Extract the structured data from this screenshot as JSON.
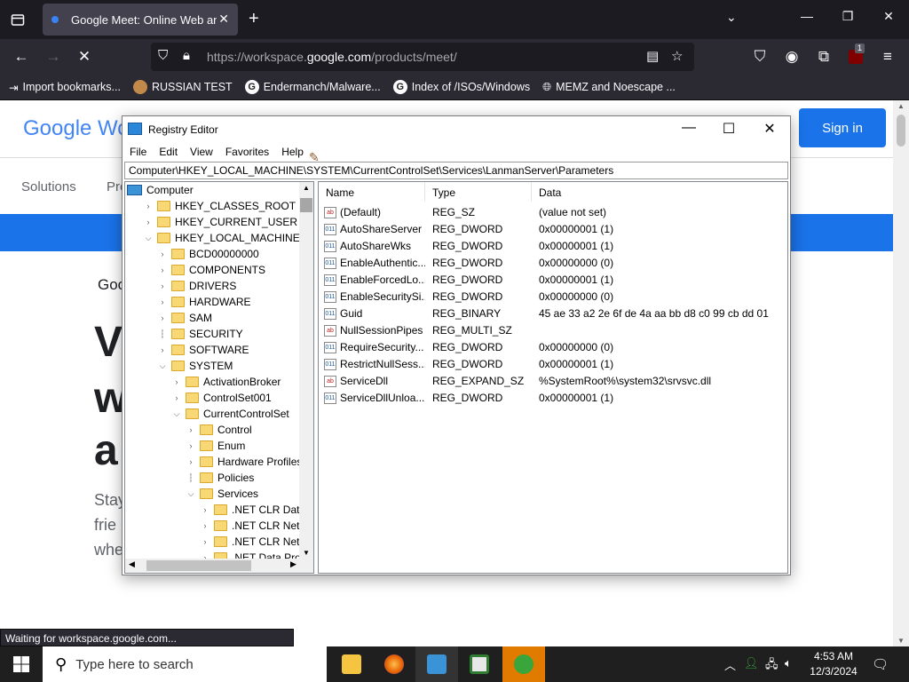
{
  "browser": {
    "tab_title": "Google Meet: Online Web and V",
    "url_prefix": "https://workspace.",
    "url_domain": "google.com",
    "url_suffix": "/products/meet/",
    "status_text": "Waiting for workspace.google.com...",
    "bookmarks": [
      {
        "label": "Import bookmarks...",
        "icon": "import-icon"
      },
      {
        "label": "RUSSIAN TEST",
        "icon": "site-icon"
      },
      {
        "label": "Endermanch/Malware...",
        "icon": "google-icon"
      },
      {
        "label": "Index of /ISOs/Windows",
        "icon": "google-icon"
      },
      {
        "label": "MEMZ and Noescape ...",
        "icon": "globe-icon"
      }
    ],
    "extension_badge": "1"
  },
  "page": {
    "logo_text": "Google Wo",
    "signin_label": "Sign in",
    "nav_solutions": "Solutions",
    "nav_pr": "Pro",
    "goc_text": "Goo",
    "big_lines": [
      "V",
      "w",
      "a"
    ],
    "small_lines": [
      "Stay",
      "frie",
      "whe"
    ]
  },
  "regedit": {
    "title": "Registry Editor",
    "menu": [
      "File",
      "Edit",
      "View",
      "Favorites",
      "Help"
    ],
    "address": "Computer\\HKEY_LOCAL_MACHINE\\SYSTEM\\CurrentControlSet\\Services\\LanmanServer\\Parameters",
    "tree": [
      {
        "label": "Computer",
        "level": 0,
        "arrow": "",
        "icon": "computer"
      },
      {
        "label": "HKEY_CLASSES_ROOT",
        "level": 1,
        "arrow": ">"
      },
      {
        "label": "HKEY_CURRENT_USER",
        "level": 1,
        "arrow": ">"
      },
      {
        "label": "HKEY_LOCAL_MACHINE",
        "level": 1,
        "arrow": "v"
      },
      {
        "label": "BCD00000000",
        "level": 2,
        "arrow": ">"
      },
      {
        "label": "COMPONENTS",
        "level": 2,
        "arrow": ">"
      },
      {
        "label": "DRIVERS",
        "level": 2,
        "arrow": ">"
      },
      {
        "label": "HARDWARE",
        "level": 2,
        "arrow": ">"
      },
      {
        "label": "SAM",
        "level": 2,
        "arrow": ">"
      },
      {
        "label": "SECURITY",
        "level": 2,
        "arrow": ""
      },
      {
        "label": "SOFTWARE",
        "level": 2,
        "arrow": ">"
      },
      {
        "label": "SYSTEM",
        "level": 2,
        "arrow": "v"
      },
      {
        "label": "ActivationBroker",
        "level": 3,
        "arrow": ">"
      },
      {
        "label": "ControlSet001",
        "level": 3,
        "arrow": ">"
      },
      {
        "label": "CurrentControlSet",
        "level": 3,
        "arrow": "v"
      },
      {
        "label": "Control",
        "level": 4,
        "arrow": ">"
      },
      {
        "label": "Enum",
        "level": 4,
        "arrow": ">"
      },
      {
        "label": "Hardware Profiles",
        "level": 4,
        "arrow": ">"
      },
      {
        "label": "Policies",
        "level": 4,
        "arrow": ""
      },
      {
        "label": "Services",
        "level": 4,
        "arrow": "v"
      },
      {
        "label": ".NET CLR Data",
        "level": 5,
        "arrow": ">"
      },
      {
        "label": ".NET CLR Network",
        "level": 5,
        "arrow": ">"
      },
      {
        "label": ".NET CLR Network",
        "level": 5,
        "arrow": ">"
      },
      {
        "label": ".NET Data Provide",
        "level": 5,
        "arrow": ">"
      }
    ],
    "columns": [
      "Name",
      "Type",
      "Data"
    ],
    "values": [
      {
        "name": "(Default)",
        "type": "REG_SZ",
        "data": "(value not set)",
        "icon": "string"
      },
      {
        "name": "AutoShareServer",
        "type": "REG_DWORD",
        "data": "0x00000001 (1)",
        "icon": "binary"
      },
      {
        "name": "AutoShareWks",
        "type": "REG_DWORD",
        "data": "0x00000001 (1)",
        "icon": "binary"
      },
      {
        "name": "EnableAuthentic...",
        "type": "REG_DWORD",
        "data": "0x00000000 (0)",
        "icon": "binary"
      },
      {
        "name": "EnableForcedLo...",
        "type": "REG_DWORD",
        "data": "0x00000001 (1)",
        "icon": "binary"
      },
      {
        "name": "EnableSecuritySi...",
        "type": "REG_DWORD",
        "data": "0x00000000 (0)",
        "icon": "binary"
      },
      {
        "name": "Guid",
        "type": "REG_BINARY",
        "data": "45 ae 33 a2 2e 6f de 4a aa bb d8 c0 99 cb dd 01",
        "icon": "binary"
      },
      {
        "name": "NullSessionPipes",
        "type": "REG_MULTI_SZ",
        "data": "",
        "icon": "string"
      },
      {
        "name": "RequireSecurity...",
        "type": "REG_DWORD",
        "data": "0x00000000 (0)",
        "icon": "binary"
      },
      {
        "name": "RestrictNullSess...",
        "type": "REG_DWORD",
        "data": "0x00000001 (1)",
        "icon": "binary"
      },
      {
        "name": "ServiceDll",
        "type": "REG_EXPAND_SZ",
        "data": "%SystemRoot%\\system32\\srvsvc.dll",
        "icon": "string"
      },
      {
        "name": "ServiceDllUnloa...",
        "type": "REG_DWORD",
        "data": "0x00000001 (1)",
        "icon": "binary"
      }
    ]
  },
  "taskbar": {
    "search_placeholder": "Type here to search",
    "time": "4:53 AM",
    "date": "12/3/2024"
  },
  "colors": {
    "accent_blue": "#1a73e8",
    "firefox_dark": "#1c1b22"
  }
}
